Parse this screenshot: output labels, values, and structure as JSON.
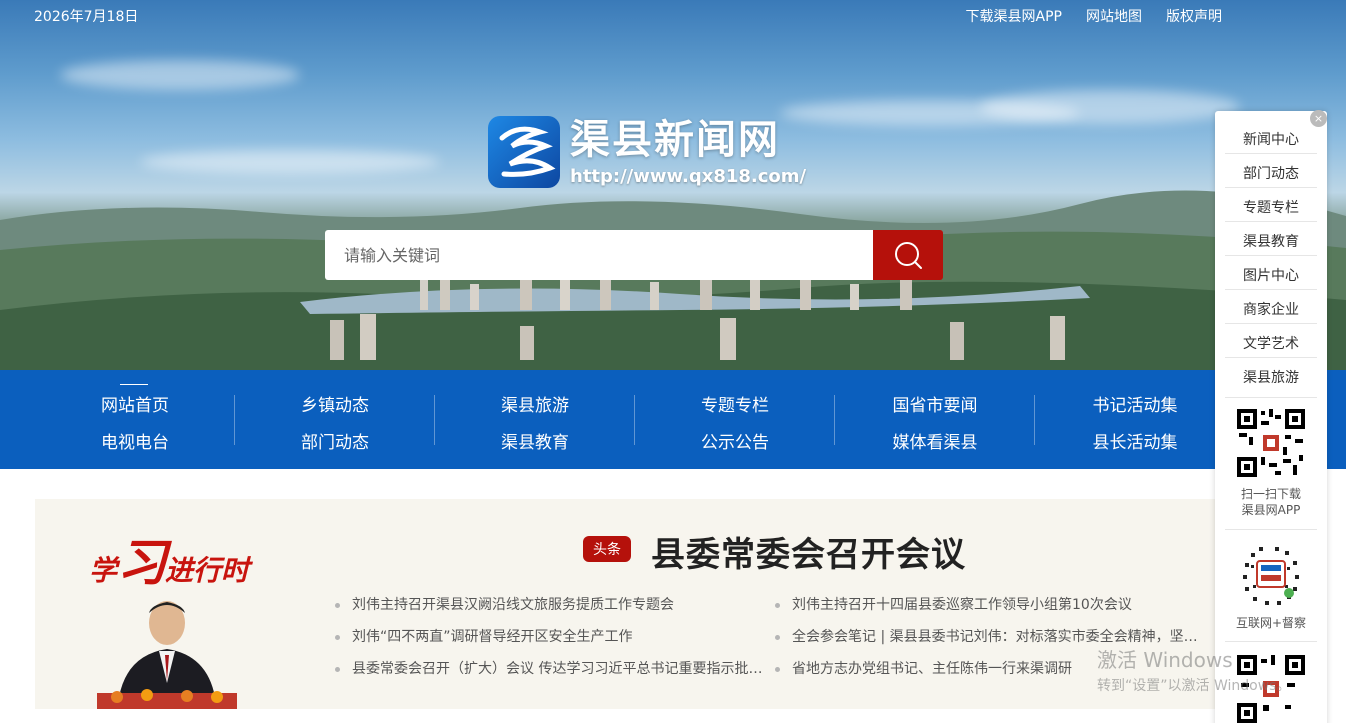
{
  "topbar": {
    "date": "2026年7月18日",
    "links": [
      "下载渠县网APP",
      "网站地图",
      "版权声明"
    ]
  },
  "logo": {
    "title": "渠县新闻网",
    "url": "http://www.qx818.com/"
  },
  "search": {
    "placeholder": "请输入关键词"
  },
  "nav": {
    "columns": [
      [
        "网站首页",
        "电视电台"
      ],
      [
        "乡镇动态",
        "部门动态"
      ],
      [
        "渠县旅游",
        "渠县教育"
      ],
      [
        "专题专栏",
        "公示公告"
      ],
      [
        "国省市要闻",
        "媒体看渠县"
      ],
      [
        "书记活动集",
        "县长活动集"
      ]
    ]
  },
  "study": {
    "part1": "学",
    "part2": "习",
    "part3": "进行时"
  },
  "headline": {
    "tag": "头条",
    "title": "县委常委会召开会议",
    "left_items": [
      "刘伟主持召开渠县汉阙沿线文旅服务提质工作专题会",
      "刘伟“四不两直”调研督导经开区安全生产工作",
      "县委常委会召开（扩大）会议 传达学习习近平总书记重要指示批…"
    ],
    "right_items": [
      "刘伟主持召开十四届县委巡察工作领导小组第10次会议",
      "全会参会笔记 | 渠县县委书记刘伟：对标落实市委全会精神，坚…",
      "省地方志办党组书记、主任陈伟一行来渠调研"
    ]
  },
  "sidebar": {
    "close": "×",
    "items": [
      "新闻中心",
      "部门动态",
      "专题专栏",
      "渠县教育",
      "图片中心",
      "商家企业",
      "文学艺术",
      "渠县旅游"
    ],
    "qr1_caption_line1": "扫一扫下载",
    "qr1_caption_line2": "渠县网APP",
    "qr2_caption": "互联网+督察"
  },
  "watermark": {
    "line1": "激活 Windows",
    "line2": "转到“设置”以激活 Windows。"
  },
  "colors": {
    "nav_blue": "#0b5fbe",
    "accent_red": "#b5110b"
  }
}
